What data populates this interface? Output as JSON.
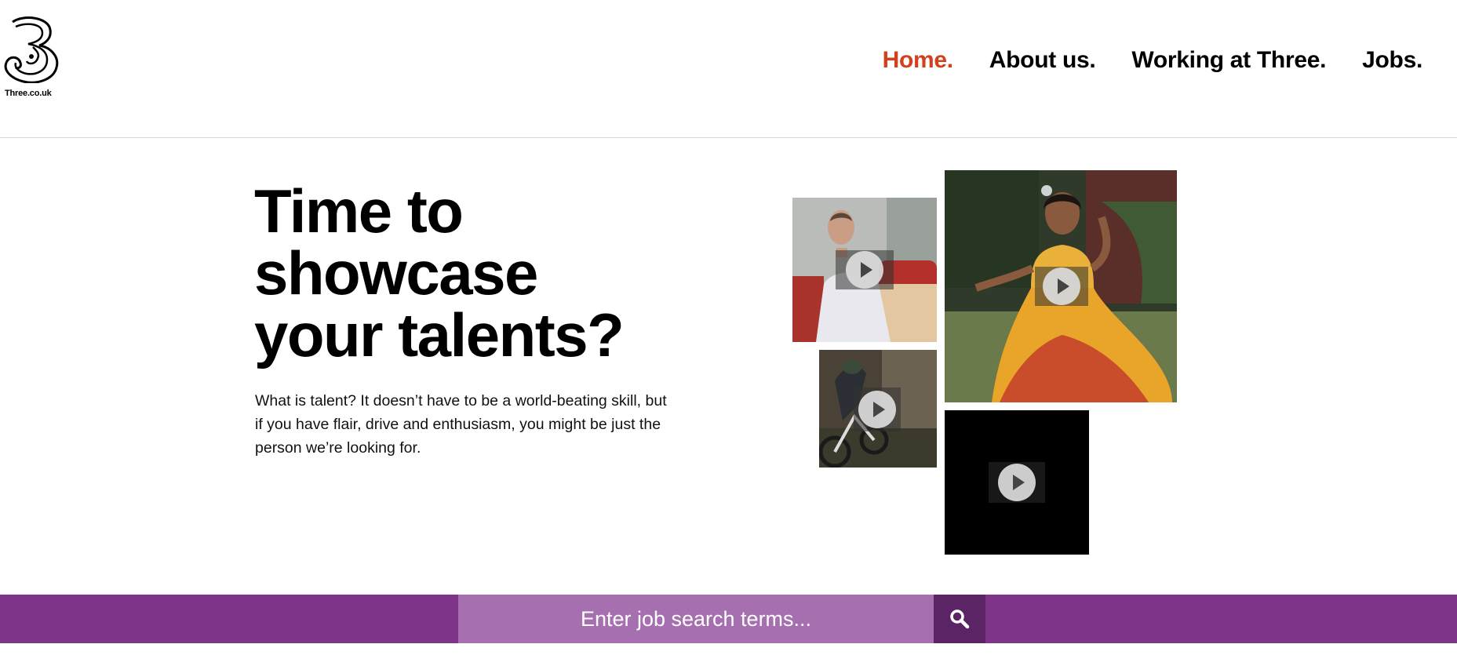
{
  "brand": {
    "logo_text": "Three.co.uk",
    "accent_color": "#d2401e",
    "band_color": "#7e3589"
  },
  "nav": {
    "items": [
      {
        "label": "Home.",
        "active": true
      },
      {
        "label": "About us.",
        "active": false
      },
      {
        "label": "Working at Three.",
        "active": false
      },
      {
        "label": "Jobs.",
        "active": false
      }
    ]
  },
  "hero": {
    "title_lines": [
      "Time to",
      "showcase",
      "your talents?"
    ],
    "body": "What is talent? It doesn’t have to be a world-beating skill, but if you have flair, drive and enthusiasm, you might be just the person we’re looking for."
  },
  "videos": {
    "icon": "play-icon"
  },
  "search": {
    "placeholder": "Enter job search terms...",
    "value": "",
    "button_icon": "search-icon"
  }
}
